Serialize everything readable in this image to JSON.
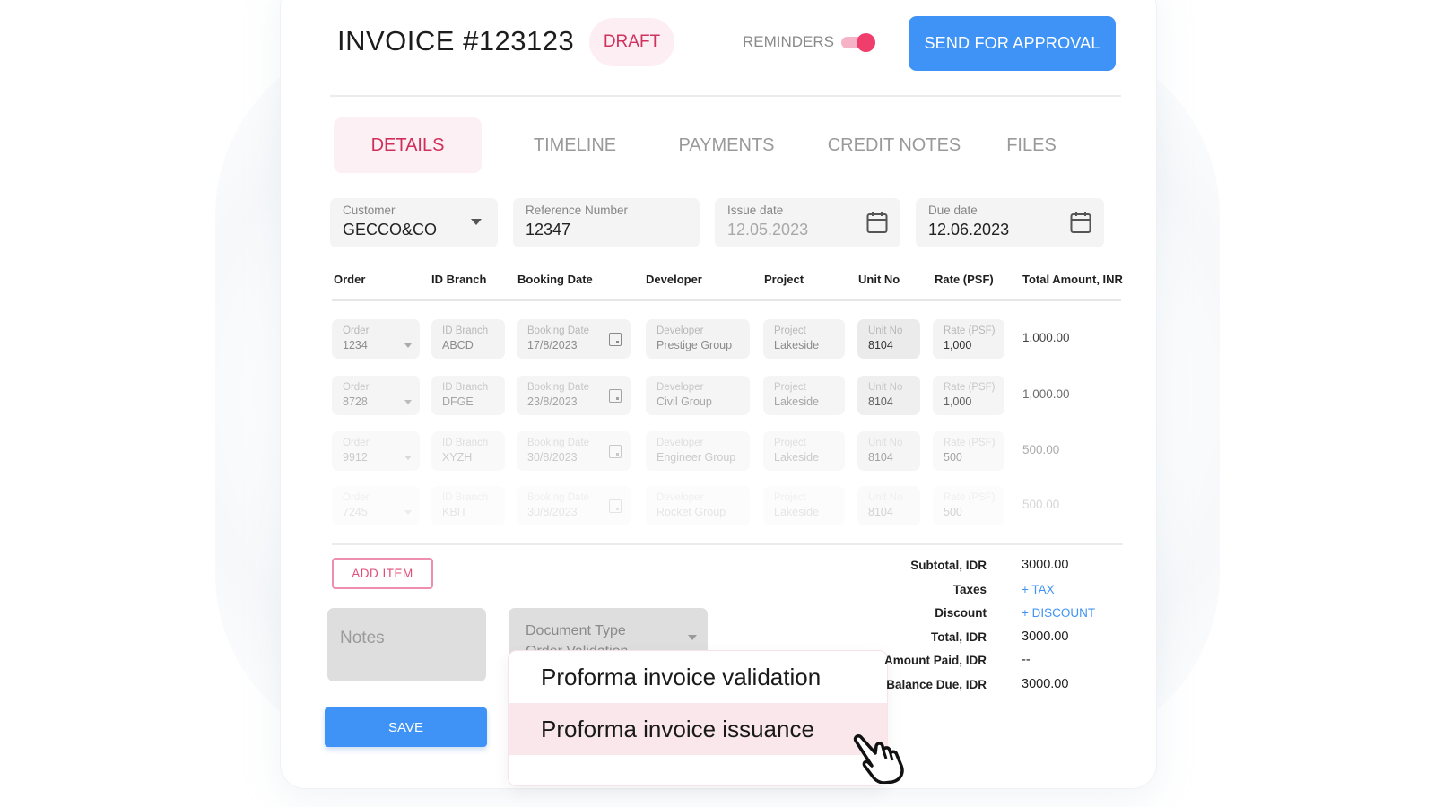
{
  "header": {
    "title": "INVOICE #123123",
    "status_badge": "DRAFT",
    "reminders_label": "REMINDERS",
    "reminders_on": true,
    "send_button": "SEND FOR APPROVAL"
  },
  "tabs": [
    {
      "label": "DETAILS",
      "active": true
    },
    {
      "label": "TIMELINE",
      "active": false
    },
    {
      "label": "PAYMENTS",
      "active": false
    },
    {
      "label": "CREDIT NOTES",
      "active": false
    },
    {
      "label": "FILES",
      "active": false
    }
  ],
  "fields": {
    "customer": {
      "label": "Customer",
      "value": "GECCO&CO"
    },
    "reference": {
      "label": "Reference Number",
      "value": "12347"
    },
    "issue_date": {
      "label": "Issue date",
      "value": "12.05.2023"
    },
    "due_date": {
      "label": "Due date",
      "value": "12.06.2023"
    }
  },
  "table": {
    "columns": [
      "Order",
      "ID Branch",
      "Booking Date",
      "Developer",
      "Project",
      "Unit No",
      "Rate (PSF)",
      "Total Amount, INR"
    ],
    "cell_labels": [
      "Order",
      "ID Branch",
      "Booking Date",
      "Developer",
      "Project",
      "Unit No",
      "Rate (PSF)"
    ],
    "rows": [
      {
        "order": "1234",
        "branch": "ABCD",
        "date": "17/8/2023",
        "developer": "Prestige Group",
        "project": "Lakeside",
        "unit": "8104",
        "rate": "1,000",
        "total": "1,000.00"
      },
      {
        "order": "8728",
        "branch": "DFGE",
        "date": "23/8/2023",
        "developer": "Civil Group",
        "project": "Lakeside",
        "unit": "8104",
        "rate": "1,000",
        "total": "1,000.00"
      },
      {
        "order": "9912",
        "branch": "XYZH",
        "date": "30/8/2023",
        "developer": "Engineer Group",
        "project": "Lakeside",
        "unit": "8104",
        "rate": "500",
        "total": "500.00"
      },
      {
        "order": "7245",
        "branch": "KBIT",
        "date": "30/8/2023",
        "developer": "Rocket Group",
        "project": "Lakeside",
        "unit": "8104",
        "rate": "500",
        "total": "500.00"
      }
    ]
  },
  "actions": {
    "add_item": "ADD ITEM",
    "notes_placeholder": "Notes",
    "save": "SAVE"
  },
  "document_type": {
    "label": "Document Type",
    "value": "Order Validation",
    "options": [
      "Proforma invoice validation",
      "Proforma invoice issuance"
    ],
    "hovered_index": 1
  },
  "totals": {
    "subtotal": {
      "label": "Subtotal, IDR",
      "value": "3000.00"
    },
    "taxes": {
      "label": "Taxes",
      "link": "+ TAX"
    },
    "discount": {
      "label": "Discount",
      "link": "+ DISCOUNT"
    },
    "total": {
      "label": "Total, IDR",
      "value": "3000.00"
    },
    "amount_paid": {
      "label": "Amount Paid, IDR",
      "value": "--"
    },
    "balance_due": {
      "label": "Balance Due, IDR",
      "value": "3000.00"
    }
  },
  "colors": {
    "accent_pink": "#d0325f",
    "primary_blue": "#3f93f6",
    "toggle_on": "#f03e6c"
  }
}
